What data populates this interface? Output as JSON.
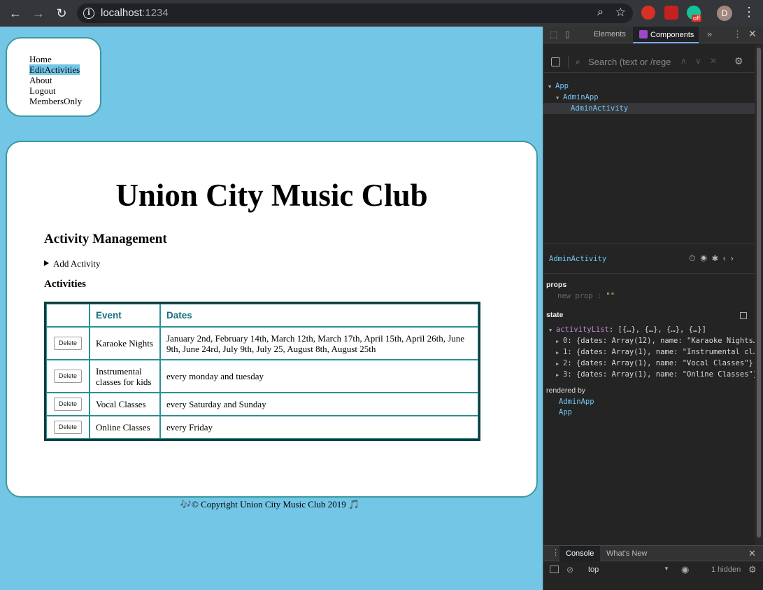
{
  "browser": {
    "url_host": "localhost",
    "url_port": ":1234",
    "avatar_letter": "D",
    "ext_badge": "off"
  },
  "site": {
    "nav": [
      {
        "label": "Home",
        "active": false
      },
      {
        "label": "EditActivities",
        "active": true
      },
      {
        "label": "About",
        "active": false
      },
      {
        "label": "Logout",
        "active": false
      },
      {
        "label": "MembersOnly",
        "active": false
      }
    ],
    "title": "Union City Music Club",
    "section_title": "Activity Management",
    "add_activity": "Add Activity",
    "activities_title": "Activities",
    "table": {
      "headers": [
        "",
        "Event",
        "Dates"
      ],
      "delete_label": "Delete",
      "rows": [
        {
          "event": "Karaoke Nights",
          "dates": "January 2nd, February 14th, March 12th, March 17th, April 15th, April 26th, June 9th, June 24rd, July 9th, July 25, August 8th, August 25th"
        },
        {
          "event": "Instrumental classes for kids",
          "dates": "every monday and tuesday"
        },
        {
          "event": "Vocal Classes",
          "dates": "every Saturday and Sunday"
        },
        {
          "event": "Online Classes",
          "dates": "every Friday"
        }
      ]
    },
    "footer": "🎶© Copyright Union City Music Club 2019 🎵"
  },
  "devtools": {
    "tabs": {
      "elements": "Elements",
      "components": "Components"
    },
    "search_placeholder": "Search (text or /regex/)",
    "tree": [
      {
        "label": "App",
        "indent": 0,
        "caret": true,
        "selected": false
      },
      {
        "label": "AdminApp",
        "indent": 1,
        "caret": true,
        "selected": false
      },
      {
        "label": "AdminActivity",
        "indent": 2,
        "caret": false,
        "selected": true
      }
    ],
    "inspector": {
      "name": "AdminActivity",
      "props_label": "props",
      "new_prop": "new prop",
      "new_prop_value": "\"\"",
      "state_label": "state",
      "activity_list_key": "activityList",
      "activity_list_summary": "[{…}, {…}, {…}, {…}]",
      "items": [
        {
          "index": "0",
          "value": "{dates: Array(12), name: \"Karaoke Nights…"
        },
        {
          "index": "1",
          "value": "{dates: Array(1), name: \"Instrumental cl…"
        },
        {
          "index": "2",
          "value": "{dates: Array(1), name: \"Vocal Classes\"}"
        },
        {
          "index": "3",
          "value": "{dates: Array(1), name: \"Online Classes\"}"
        }
      ],
      "rendered_by_label": "rendered by",
      "rendered_by": [
        "AdminApp",
        "App"
      ]
    },
    "drawer": {
      "console_tab": "Console",
      "whats_new_tab": "What's New",
      "context": "top",
      "hidden": "1 hidden"
    }
  }
}
